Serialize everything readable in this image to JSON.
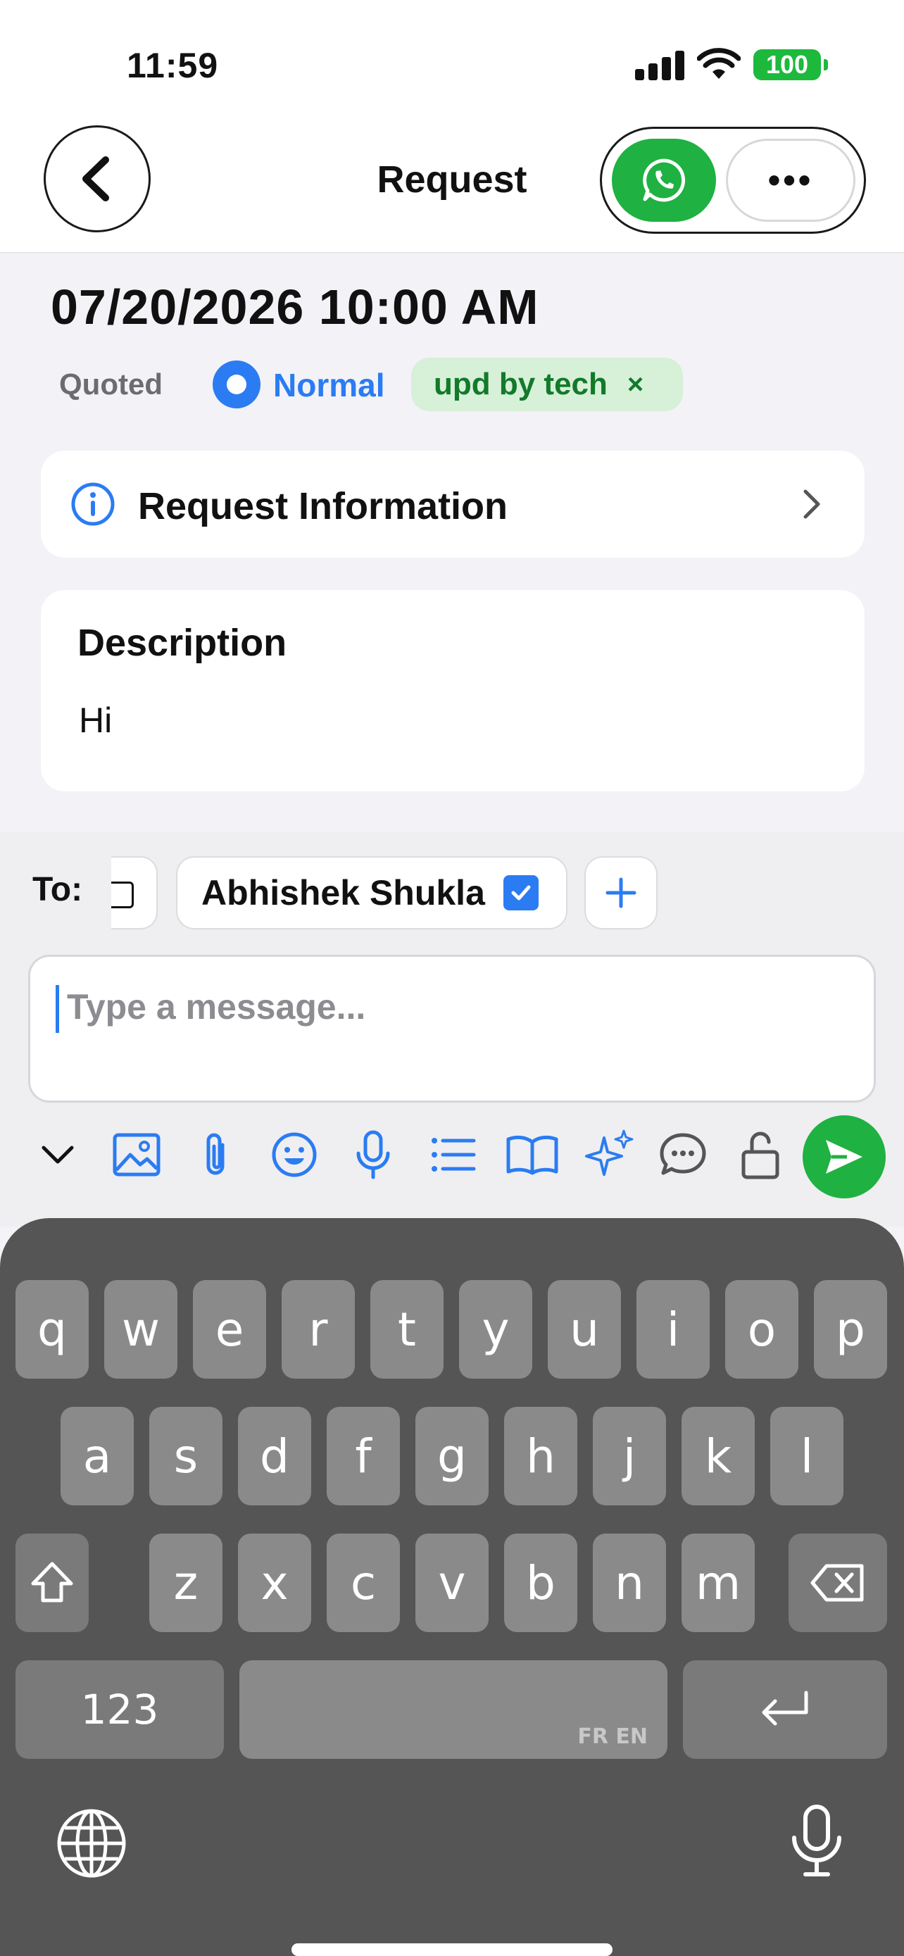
{
  "status_bar": {
    "time": "11:59",
    "battery": "100"
  },
  "header": {
    "title": "Request"
  },
  "request": {
    "datetime": "07/20/2026 10:00 AM",
    "status": "Quoted",
    "priority": "Normal",
    "tag": "upd by tech",
    "tag_remove": "×"
  },
  "info_card": {
    "label": "Request Information"
  },
  "description": {
    "title": "Description",
    "text": "Hi"
  },
  "composer": {
    "to_label": "To:",
    "recipient": "Abhishek Shukla",
    "recipient_checked": true,
    "message_placeholder": "Type a message..."
  },
  "toolbar": {
    "icons": [
      "chevron-down-icon",
      "image-icon",
      "paperclip-icon",
      "emoji-icon",
      "microphone-icon",
      "list-icon",
      "book-icon",
      "sparkles-icon",
      "chat-bubble-icon",
      "unlock-icon",
      "send-icon"
    ]
  },
  "keyboard": {
    "row1": [
      "q",
      "w",
      "e",
      "r",
      "t",
      "y",
      "u",
      "i",
      "o",
      "p"
    ],
    "row2": [
      "a",
      "s",
      "d",
      "f",
      "g",
      "h",
      "j",
      "k",
      "l"
    ],
    "row3": [
      "z",
      "x",
      "c",
      "v",
      "b",
      "n",
      "m"
    ],
    "numbers_key": "123",
    "space_languages": "FR EN"
  },
  "colors": {
    "accent_blue": "#2b7cf2",
    "whatsapp_green": "#1fb141",
    "tag_bg": "#d7f0d8",
    "tag_text": "#127a2a",
    "keyboard_bg": "#555555",
    "key_bg": "#8a8a8a"
  }
}
